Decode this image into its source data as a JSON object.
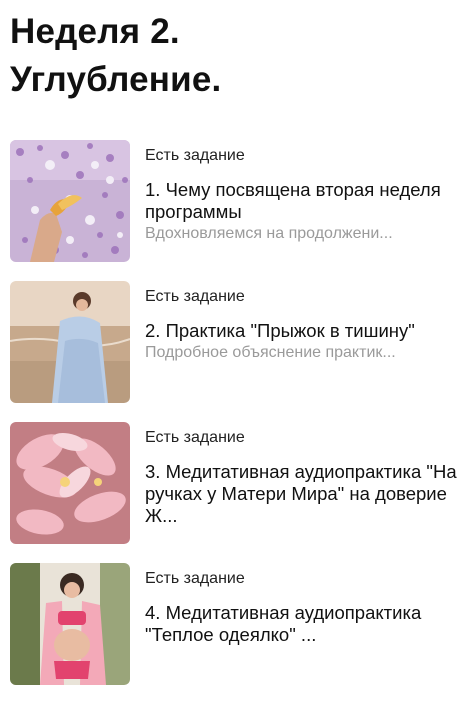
{
  "page": {
    "title_line1": "Неделя 2.",
    "title_line2": "Углубление."
  },
  "lessons": [
    {
      "badge": "Есть задание",
      "title": "1. Чему посвящена вторая неделя программы",
      "subtitle": "Вдохновляемся на продолжени...",
      "image": "flower-petals-hand-image"
    },
    {
      "badge": "Есть задание",
      "title": "2. Практика \"Прыжок в тишину\"",
      "subtitle": "Подробное объяснение практик...",
      "image": "woman-at-sea-image"
    },
    {
      "badge": "Есть задание",
      "title": "3. Медитативная аудиопрактика \"На ручках у Матери Мира\" на доверие Ж...",
      "subtitle": "",
      "image": "pink-plumeria-image"
    },
    {
      "badge": "Есть задание",
      "title": "4. Медитативная аудиопрактика \"Теплое одеялко\" ...",
      "subtitle": "",
      "image": "pregnant-woman-pink-image"
    }
  ]
}
